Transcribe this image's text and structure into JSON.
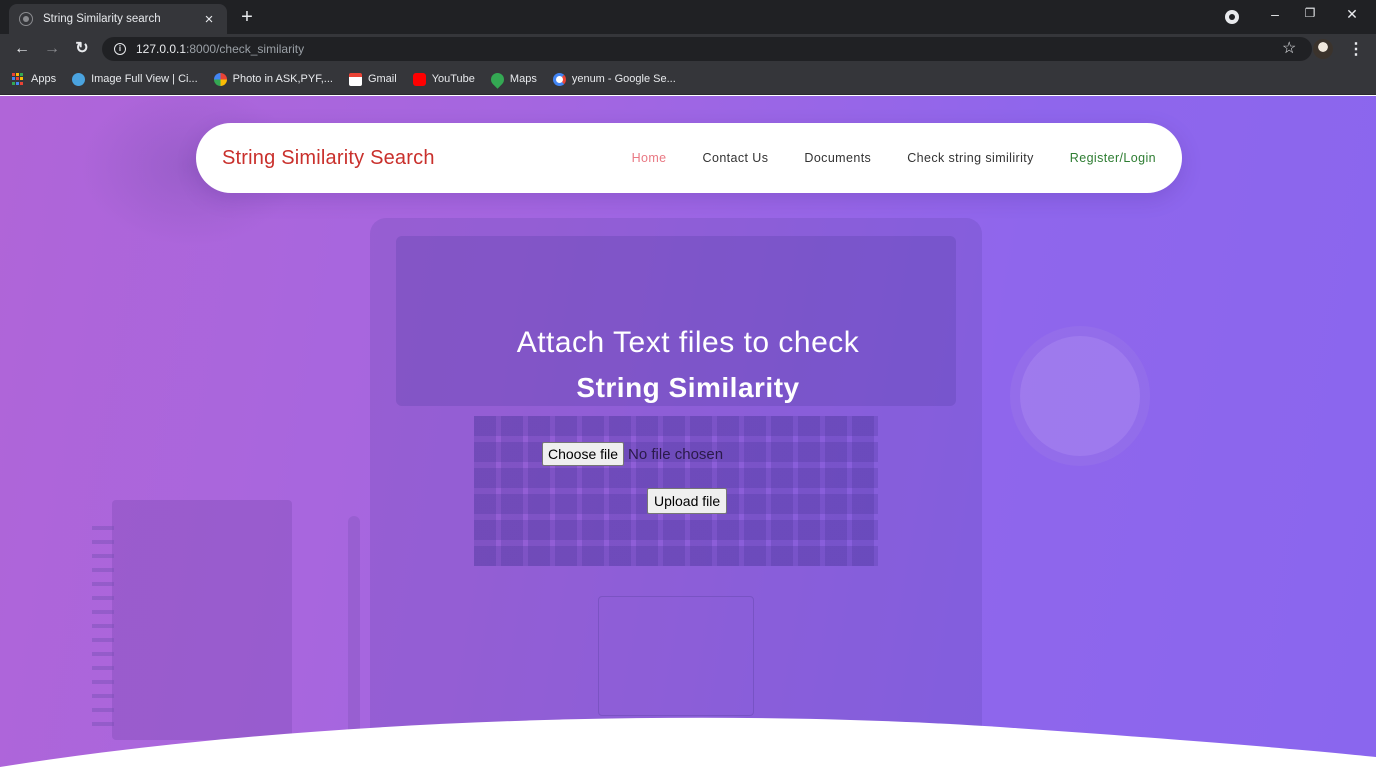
{
  "browser": {
    "tab_title": "String Similarity search",
    "tab_close": "×",
    "new_tab": "+",
    "url_host": "127.0.0.1",
    "url_rest": ":8000/check_similarity",
    "bookmarks": [
      {
        "label": "Apps",
        "icon": "apps-icon"
      },
      {
        "label": "Image Full View | Ci...",
        "icon": "globe-icon",
        "color": "#4aa3df"
      },
      {
        "label": "Photo in ASK,PYF,...",
        "icon": "pinwheel-icon",
        "color": "#f4b400"
      },
      {
        "label": "Gmail",
        "icon": "gmail-icon",
        "color": "#ea4335"
      },
      {
        "label": "YouTube",
        "icon": "youtube-icon",
        "color": "#ff0000"
      },
      {
        "label": "Maps",
        "icon": "maps-pin-icon",
        "color": "#34a853"
      },
      {
        "label": "yenum - Google Se...",
        "icon": "google-icon",
        "color": "#ffffff"
      }
    ]
  },
  "navbar": {
    "brand": "String Similarity Search",
    "links": [
      "Home",
      "Contact Us",
      "Documents",
      "Check string similirity",
      "Register/Login"
    ]
  },
  "hero": {
    "headline": "Attach Text files to check",
    "subheadline": "String Similarity",
    "choose_file_label": "Choose file",
    "file_status": "No file chosen",
    "upload_label": "Upload file"
  },
  "colors": {
    "brand": "#c9302c",
    "active_link": "#e97883",
    "login_link": "#2e7d32",
    "hero_start": "#b065d8",
    "hero_end": "#8a66ee"
  }
}
